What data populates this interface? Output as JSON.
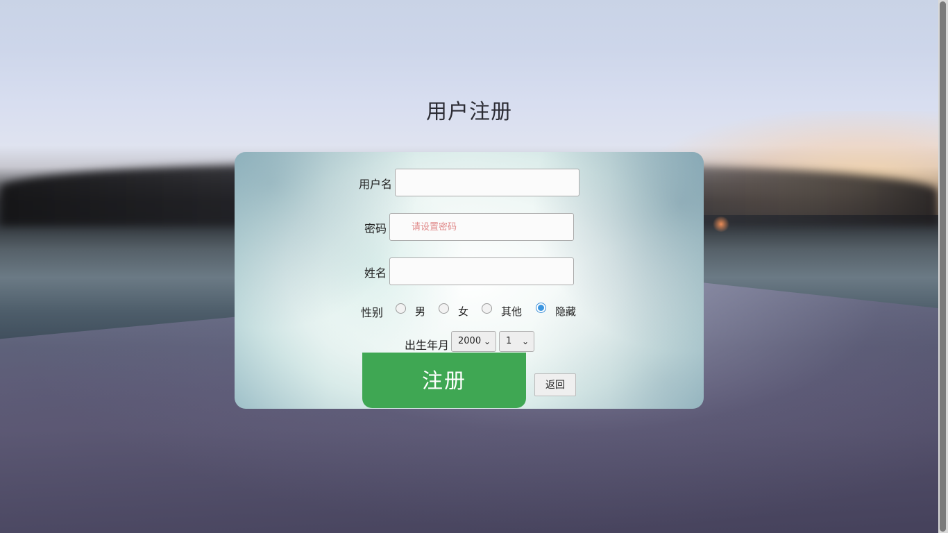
{
  "page": {
    "title": "用户注册"
  },
  "form": {
    "username": {
      "label": "用户名",
      "value": "",
      "placeholder": ""
    },
    "password": {
      "label": "密码",
      "value": "",
      "placeholder": "请设置密码"
    },
    "realname": {
      "label": "姓名",
      "value": "",
      "placeholder": ""
    },
    "gender": {
      "label": "性别",
      "options": [
        "男",
        "女",
        "其他",
        "隐藏"
      ],
      "selected": "隐藏"
    },
    "birth": {
      "label": "出生年月",
      "year": "2000",
      "month": "1"
    },
    "register_label": "注册",
    "back_label": "返回"
  },
  "icons": {
    "select_chevron": "chevron-down-icon"
  },
  "colors": {
    "register_button": "#3fa753",
    "radio_checked": "#3b96e0"
  }
}
